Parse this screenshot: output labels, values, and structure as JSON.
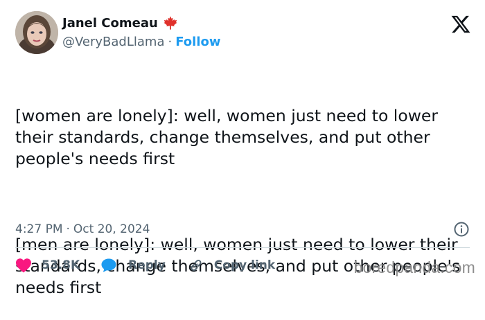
{
  "author": {
    "display_name": "Janel Comeau",
    "flag_icon": "maple-leaf-icon",
    "handle": "@VeryBadLlama",
    "separator": "·",
    "follow_label": "Follow"
  },
  "platform_icon": "x-logo-icon",
  "tweet": {
    "paragraphs": [
      "[women are lonely]: well, women just need to lower their standards, change themselves, and put other people's needs first",
      "[men are lonely]: well, women just need to lower their standards, change themselves, and put other people's needs first"
    ]
  },
  "meta": {
    "time": "4:27 PM",
    "separator": "·",
    "date": "Oct 20, 2024",
    "info_icon": "info-icon"
  },
  "actions": {
    "likes": "53.8K",
    "reply_label": "Reply",
    "copy_link_label": "Copy link"
  },
  "watermark": "boredpanda.com",
  "colors": {
    "text_primary": "#0f1419",
    "text_secondary": "#536471",
    "accent_blue": "#1d9bf0",
    "like_red": "#f91880",
    "flag_red": "#e0312b",
    "divider": "#cfd9de"
  }
}
